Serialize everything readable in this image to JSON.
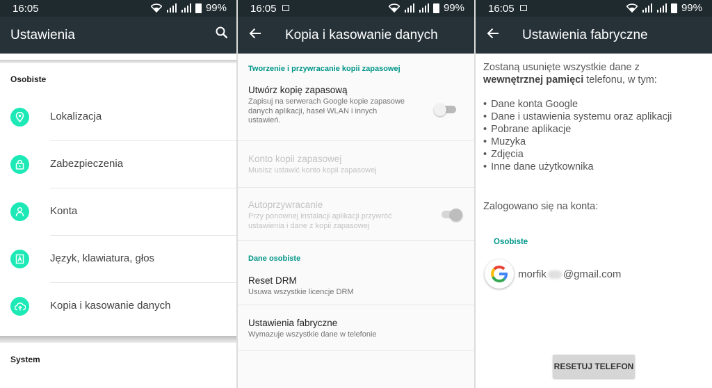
{
  "statusbar": {
    "time": "16:05",
    "battery": "99%"
  },
  "panel1": {
    "title": "Ustawienia",
    "section_personal": "Osobiste",
    "items": [
      {
        "label": "Lokalizacja",
        "icon": "location-icon"
      },
      {
        "label": "Zabezpieczenia",
        "icon": "lock-icon"
      },
      {
        "label": "Konta",
        "icon": "person-icon"
      },
      {
        "label": "Język, klawiatura, głos",
        "icon": "language-icon"
      },
      {
        "label": "Kopia i kasowanie danych",
        "icon": "cloud-upload-icon"
      }
    ],
    "section_system": "System"
  },
  "panel2": {
    "title": "Kopia i kasowanie danych",
    "section_backup": "Tworzenie i przywracanie kopii zapasowej",
    "backup": {
      "title": "Utwórz kopię zapasową",
      "desc": [
        "Zapisuj na serwerach Google kopie zapasowe",
        "danych aplikacji, haseł WLAN i innych",
        "ustawień."
      ]
    },
    "account": {
      "title": "Konto kopii zapasowej",
      "desc": [
        "Musisz ustawić konto kopii zapasowej"
      ]
    },
    "autorestore": {
      "title": "Autoprzywracanie",
      "desc": [
        "Przy ponownej instalacji aplikacji przywróć",
        "ustawienia i dane z kopii zapasowej"
      ]
    },
    "section_personal": "Dane osobiste",
    "drm": {
      "title": "Reset DRM",
      "desc": "Usuwa wszystkie licencje DRM"
    },
    "factory": {
      "title": "Ustawienia fabryczne",
      "desc": "Wymazuje wszystkie dane w telefonie"
    }
  },
  "panel3": {
    "title": "Ustawienia fabryczne",
    "intro_line1": "Zostaną usunięte wszystkie dane z",
    "intro_bold": "wewnętrznej pamięci",
    "intro_rest": " telefonu, w tym:",
    "list": [
      "Dane konta Google",
      "Dane i ustawienia systemu oraz aplikacji",
      "Pobrane aplikacje",
      "Muzyka",
      "Zdjęcia",
      "Inne dane użytkownika"
    ],
    "logged_in": "Zalogowano się na konta:",
    "section": "Osobiste",
    "email_prefix": "morfik",
    "email_suffix": "@gmail.com",
    "reset_button": "RESETUJ TELEFON"
  },
  "colors": {
    "toolbar": "#263238",
    "statusbar": "#1f2a2f",
    "accent": "#1de9b6",
    "section": "#009688"
  }
}
